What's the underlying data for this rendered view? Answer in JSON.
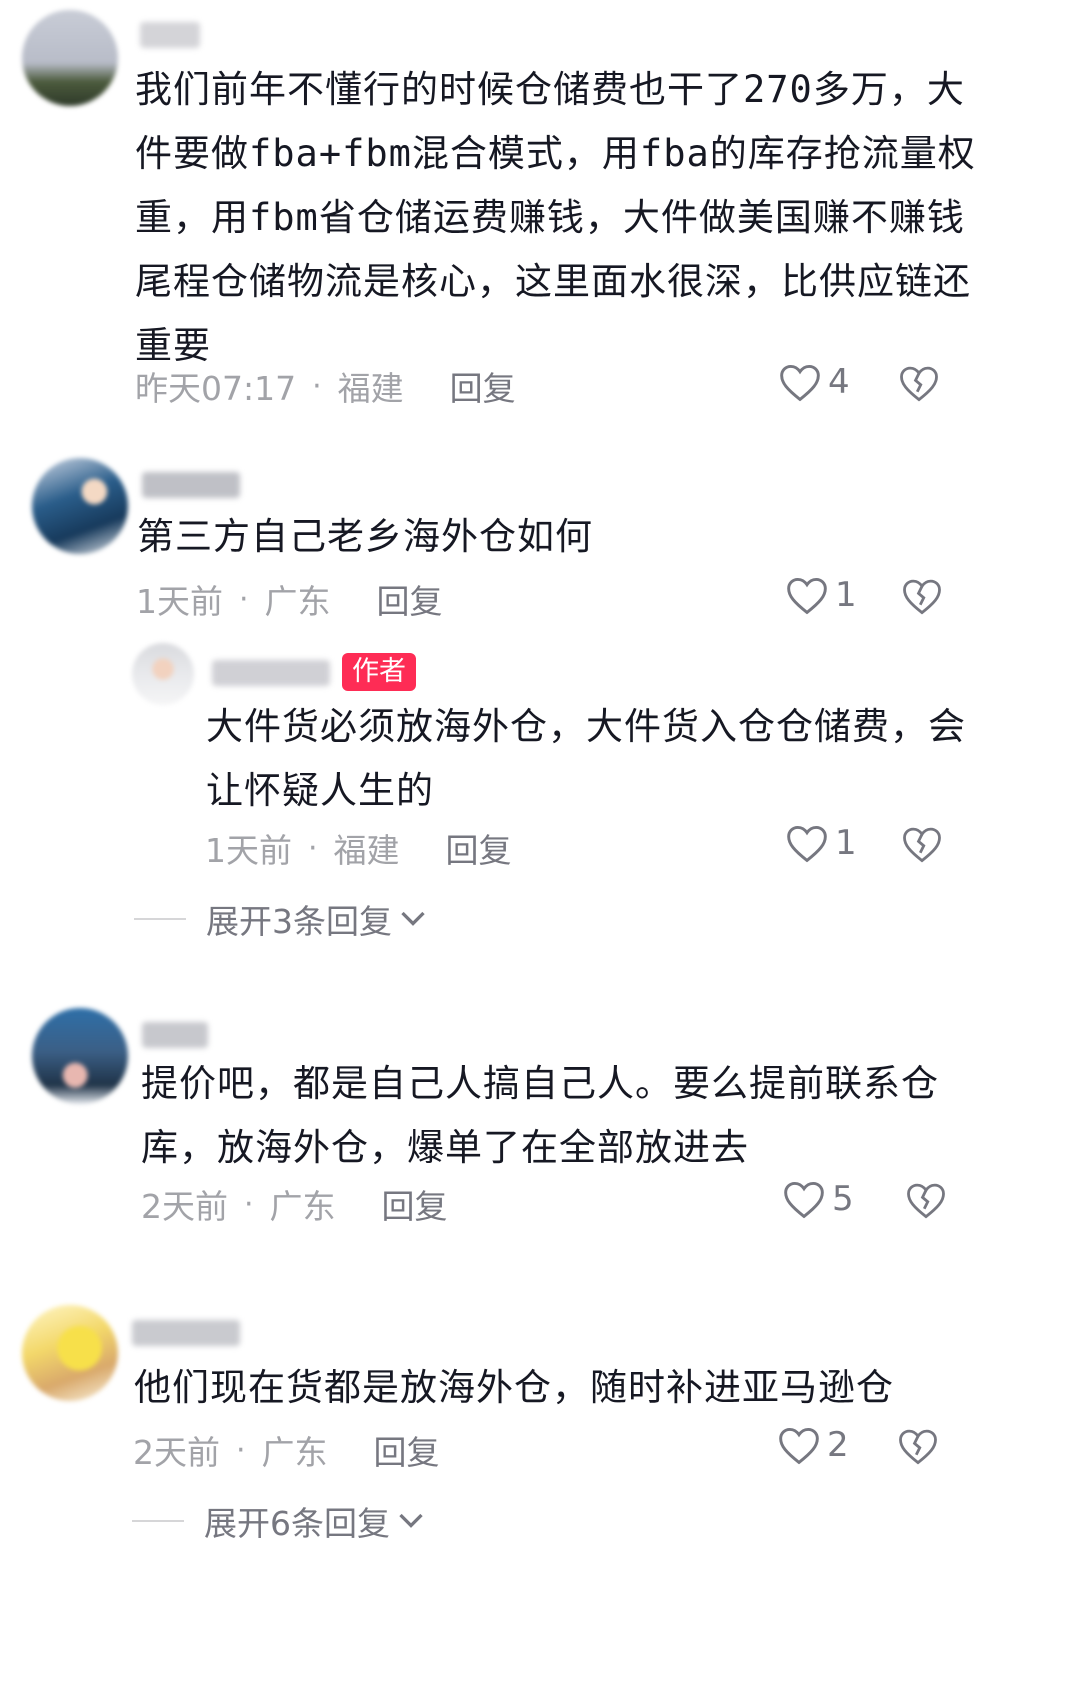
{
  "comments": [
    {
      "text": "我们前年不懂行的时候仓储费也干了270多万，大\n件要做fba+fbm混合模式，用fba的库存抢流量权\n重，用fbm省仓储运费赚钱，大件做美国赚不赚钱\n尾程仓储物流是核心，这里面水很深，比供应链还\n重要",
      "time": "昨天07:17",
      "separator": "·",
      "location": "福建",
      "reply_label": "回复",
      "likes": "4"
    },
    {
      "text": "第三方自己老乡海外仓如何",
      "time": "1天前",
      "separator": "·",
      "location": "广东",
      "reply_label": "回复",
      "likes": "1",
      "sub_reply": {
        "badge": "作者",
        "text": "大件货必须放海外仓，大件货入仓仓储费，会\n让怀疑人生的",
        "time": "1天前",
        "separator": "·",
        "location": "福建",
        "reply_label": "回复",
        "likes": "1"
      },
      "expand_label": "展开3条回复"
    },
    {
      "text": "提价吧，都是自己人搞自己人。要么提前联系仓\n库，放海外仓，爆单了在全部放进去",
      "time": "2天前",
      "separator": "·",
      "location": "广东",
      "reply_label": "回复",
      "likes": "5"
    },
    {
      "text": "他们现在货都是放海外仓，随时补进亚马逊仓",
      "time": "2天前",
      "separator": "·",
      "location": "广东",
      "reply_label": "回复",
      "likes": "2",
      "expand_label": "展开6条回复"
    }
  ],
  "colors": {
    "text": "#161823",
    "meta": "#a2a3a8",
    "reply": "#767780",
    "author_badge": "#fe2c55"
  },
  "icons": {
    "like": "heart-outline-icon",
    "dislike": "broken-heart-icon",
    "expand": "chevron-down-icon"
  }
}
